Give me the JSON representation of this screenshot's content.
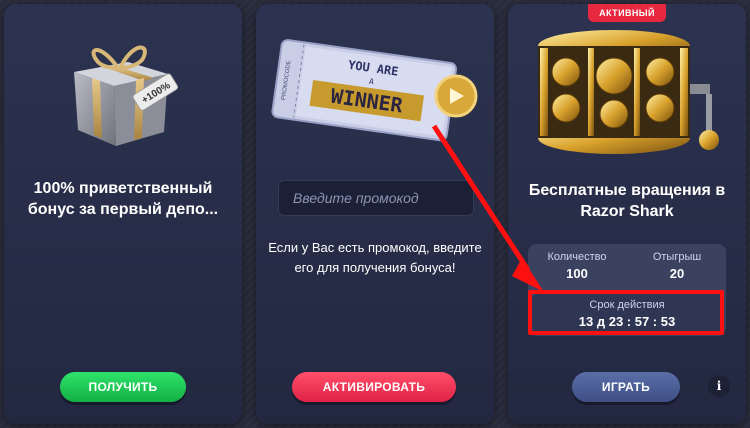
{
  "cards": [
    {
      "title": "100% приветственный бонус за первый депо...",
      "button_label": "ПОЛУЧИТЬ",
      "tag_text": "+100%",
      "image": "gift-box"
    },
    {
      "ticket_line1": "YOU ARE",
      "ticket_line2": "A",
      "ticket_main": "WINNER",
      "ticket_side": "PROMOCODE",
      "input_placeholder": "Введите промокод",
      "description": "Если у Вас есть промокод, введите его для получения бонуса!",
      "button_label": "АКТИВИРОВАТЬ",
      "image": "winner-ticket"
    },
    {
      "badge": "АКТИВНЫЙ",
      "title": "Бесплатные вращения в Razor Shark",
      "stats": {
        "quantity_label": "Количество",
        "quantity_value": "100",
        "wager_label": "Отыгрыш",
        "wager_value": "20",
        "expiry_label": "Срок действия",
        "expiry_value": "13 д 23 : 57 : 53"
      },
      "button_label": "ИГРАТЬ",
      "info_label": "i",
      "image": "slot-machine"
    }
  ],
  "annotation": {
    "arrow_color": "#ff1010",
    "highlight_color": "#ff1010"
  }
}
